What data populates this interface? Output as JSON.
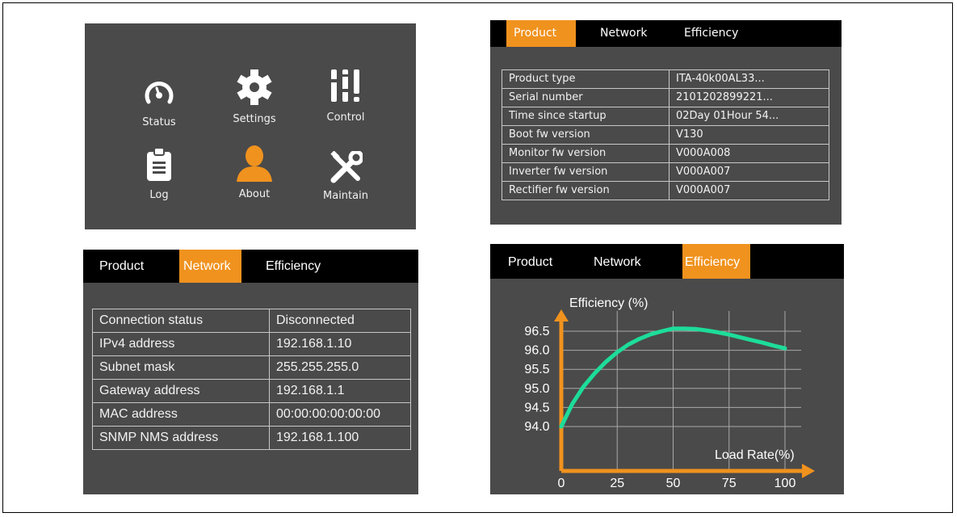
{
  "colors": {
    "accent": "#f0921e",
    "panel_bg": "#4a4a4a",
    "curve": "#1ddc9a",
    "tabbar_bg": "#000000"
  },
  "menu": {
    "items": [
      {
        "label": "Status",
        "icon": "gauge-icon"
      },
      {
        "label": "Settings",
        "icon": "gear-icon"
      },
      {
        "label": "Control",
        "icon": "sliders-icon"
      },
      {
        "label": "Log",
        "icon": "clipboard-icon"
      },
      {
        "label": "About",
        "icon": "user-icon",
        "active": true
      },
      {
        "label": "Maintain",
        "icon": "wrench-screwdriver-icon"
      }
    ]
  },
  "tabs": [
    "Product",
    "Network",
    "Efficiency"
  ],
  "product": {
    "active_tab": "Product",
    "rows": [
      [
        "Product type",
        "ITA-40k00AL33..."
      ],
      [
        "Serial number",
        "2101202899221..."
      ],
      [
        "Time since startup",
        "02Day 01Hour 54..."
      ],
      [
        "Boot fw version",
        "V130"
      ],
      [
        "Monitor fw version",
        "V000A008"
      ],
      [
        "Inverter fw version",
        "V000A007"
      ],
      [
        "Rectifier fw version",
        "V000A007"
      ]
    ]
  },
  "network": {
    "active_tab": "Network",
    "rows": [
      [
        "Connection status",
        "Disconnected"
      ],
      [
        "IPv4 address",
        "192.168.1.10"
      ],
      [
        "Subnet mask",
        "255.255.255.0"
      ],
      [
        "Gateway address",
        "192.168.1.1"
      ],
      [
        "MAC address",
        "00:00:00:00:00:00"
      ],
      [
        "SNMP NMS address",
        "192.168.1.100"
      ]
    ]
  },
  "efficiency": {
    "active_tab": "Efficiency"
  },
  "chart_data": {
    "type": "line",
    "title": "",
    "xlabel": "Load Rate(%)",
    "ylabel": "Efficiency (%)",
    "x_ticks": [
      "0",
      "25",
      "50",
      "75",
      "100"
    ],
    "y_ticks": [
      "94.0",
      "94.5",
      "95.0",
      "95.5",
      "96.0",
      "96.5"
    ],
    "xlim": [
      0,
      100
    ],
    "ylim": [
      94.0,
      96.5
    ],
    "grid": true,
    "series": [
      {
        "color": "#1ddc9a",
        "x": [
          0,
          5,
          10,
          15,
          20,
          25,
          30,
          35,
          40,
          45,
          50,
          55,
          60,
          65,
          70,
          75,
          80,
          85,
          90,
          95,
          100
        ],
        "y": [
          94.0,
          94.6,
          95.05,
          95.4,
          95.7,
          95.95,
          96.15,
          96.3,
          96.42,
          96.5,
          96.57,
          96.57,
          96.56,
          96.52,
          96.47,
          96.41,
          96.34,
          96.27,
          96.2,
          96.12,
          96.05
        ]
      }
    ]
  }
}
